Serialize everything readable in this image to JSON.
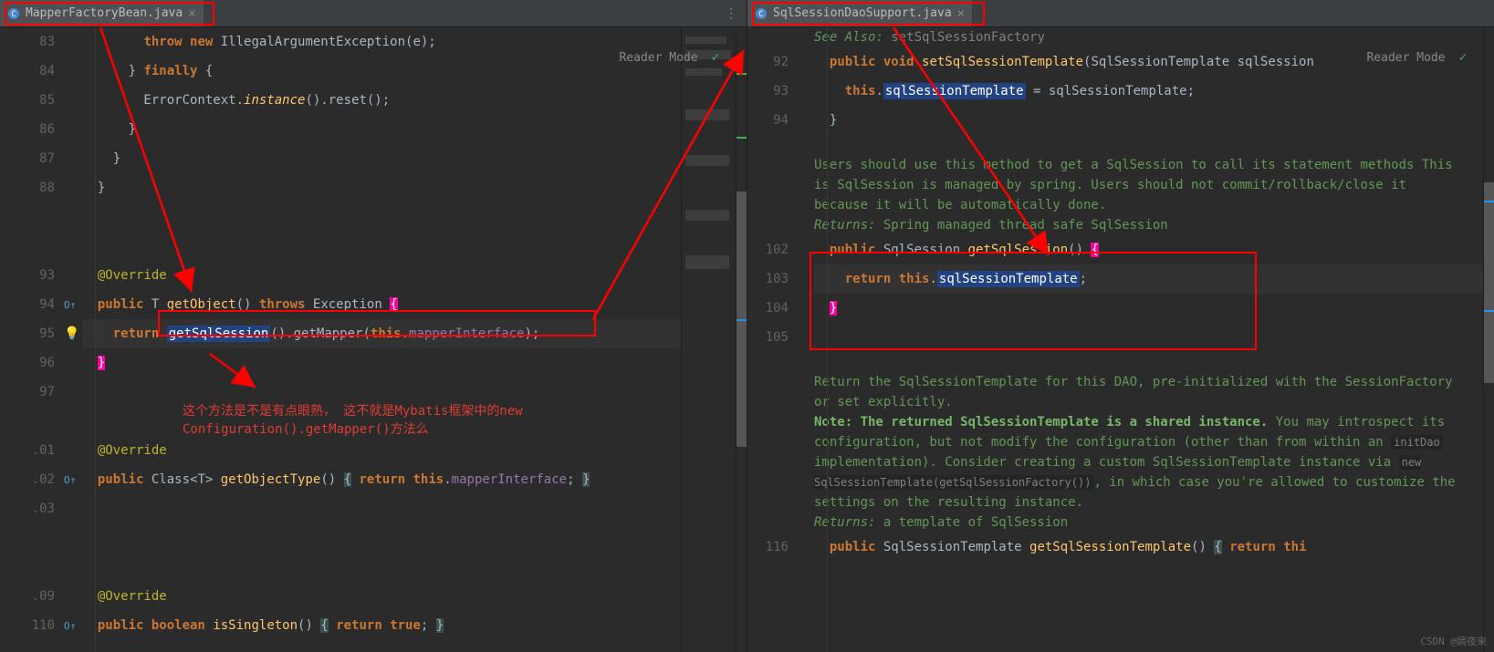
{
  "left": {
    "tab": "MapperFactoryBean.java",
    "readerMode": "Reader Mode",
    "lines": {
      "l83": "83",
      "l84": "84",
      "l85": "85",
      "l86": "86",
      "l87": "87",
      "l88": "88",
      "l93": "93",
      "l94": "94",
      "l95": "95",
      "l96": "96",
      "l97": "97",
      "l101": ".01",
      "l102": ".02",
      "l103": ".03",
      "l109": ".09",
      "l110": "110"
    },
    "code": {
      "l83a": "        ",
      "l83b": "throw new",
      "l83c": " IllegalArgumentException(e);",
      "l84a": "      } ",
      "l84b": "finally",
      "l84c": " {",
      "l85a": "        ErrorContext.",
      "l85b": "instance",
      "l85c": "().reset();",
      "l86": "      }",
      "l87": "    }",
      "l88": "  }",
      "l93a": "  ",
      "l93b": "@Override",
      "l94a": "  ",
      "l94b": "public",
      "l94c": " T ",
      "l94d": "getObject",
      "l94e": "() ",
      "l94f": "throws",
      "l94g": " Exception ",
      "l94h": "{",
      "l95a": "    ",
      "l95b": "return",
      "l95c": " ",
      "l95d": "getSqlSession",
      "l95e": "().getMapper(",
      "l95f": "this",
      "l95g": ".",
      "l95h": "mapperInterface",
      "l95i": ");",
      "l96a": "  ",
      "l96b": "}",
      "l101a": "  ",
      "l101b": "@Override",
      "l102a": "  ",
      "l102b": "public",
      "l102c": " Class<T> ",
      "l102d": "getObjectType",
      "l102e": "() ",
      "l102f": "{",
      "l102g": " ",
      "l102h": "return",
      "l102i": " ",
      "l102j": "this",
      "l102k": ".",
      "l102l": "mapperInterface",
      "l102m": "; ",
      "l102n": "}",
      "l109a": "  ",
      "l109b": "@Override",
      "l110a": "  ",
      "l110b": "public boolean",
      "l110c": " ",
      "l110d": "isSingleton",
      "l110e": "() ",
      "l110f": "{",
      "l110g": " ",
      "l110h": "return true",
      "l110i": "; ",
      "l110j": "}"
    },
    "annotation": "这个方法是不是有点眼熟，   这不就是Mybatis框架中的new Configuration().getMapper()方法么"
  },
  "right": {
    "tab": "SqlSessionDaoSupport.java",
    "readerMode": "Reader Mode",
    "lines": {
      "l92": "92",
      "l93": "93",
      "l94": "94",
      "l102": "102",
      "l103": "103",
      "l104": "104",
      "l105": "105",
      "l116": "116"
    },
    "doc": {
      "seeAlso": "See Also: ",
      "seeAlsoRef": "setSqlSessionFactory",
      "para1": "Users should use this method to get a SqlSession to call its statement methods This is SqlSession is managed by spring. Users should not commit/rollback/close it because it will be automatically done.",
      "returns1a": "Returns: ",
      "returns1b": "Spring managed thread safe SqlSession",
      "para2a": "Return the SqlSessionTemplate for this DAO, pre-initialized with the SessionFactory or set explicitly.",
      "noteBold": "Note: The returned SqlSessionTemplate is a shared instance.",
      "noteRest1": " You may introspect its configuration, but not modify the configuration (other than from within an ",
      "noteCode1": "initDao",
      "noteRest2": " implementation). Consider creating a custom SqlSessionTemplate instance via ",
      "noteCode2": "new SqlSessionTemplate(getSqlSessionFactory())",
      "noteRest3": ", in which case you're allowed to customize the settings on the resulting instance.",
      "returns2a": "Returns: ",
      "returns2b": "a template of SqlSession"
    },
    "code": {
      "l92a": "  ",
      "l92b": "public void",
      "l92c": " ",
      "l92d": "setSqlSessionTemplate",
      "l92e": "(SqlSessionTemplate sqlSession",
      "l93a": "    ",
      "l93b": "this",
      "l93c": ".",
      "l93d": "sqlSessionTemplate",
      "l93e": " = sqlSessionTemplate;",
      "l94": "  }",
      "l102a": "  ",
      "l102b": "public",
      "l102c": " SqlSession ",
      "l102d": "getSqlSession",
      "l102e": "() ",
      "l102f": "{",
      "l103a": "    ",
      "l103b": "return",
      "l103c": " ",
      "l103d": "this",
      "l103e": ".",
      "l103f": "sqlSessionTemplate",
      "l103g": ";",
      "l104a": "  ",
      "l104b": "}",
      "l116a": "  ",
      "l116b": "public",
      "l116c": " SqlSessionTemplate ",
      "l116d": "getSqlSessionTemplate",
      "l116e": "() ",
      "l116f": "{",
      "l116g": " ",
      "l116h": "return",
      "l116i": " ",
      "l116j": "thi"
    }
  },
  "watermark": "CSDN @嫣夜来"
}
